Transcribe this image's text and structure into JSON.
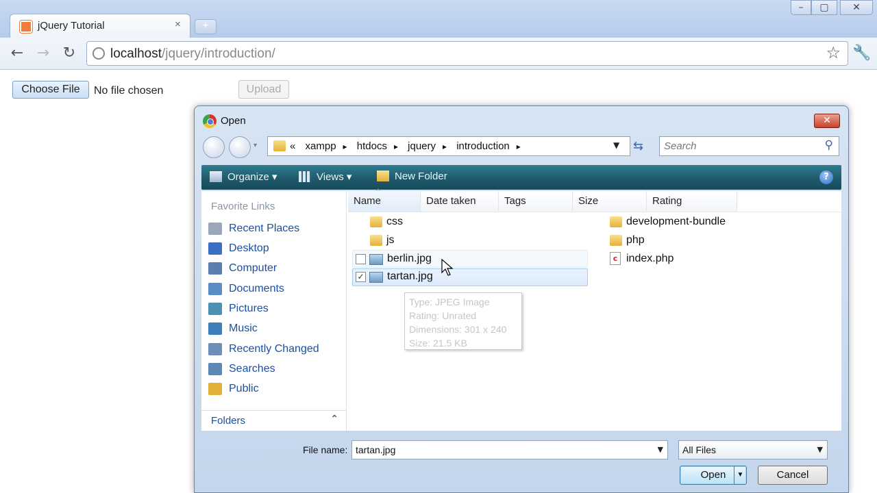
{
  "browser": {
    "tab_title": "jQuery Tutorial",
    "tab_close": "×",
    "new_tab": "+",
    "url_host": "localhost",
    "url_path": "/jquery/introduction/",
    "back": "←",
    "forward": "→",
    "reload": "↻",
    "bookmark": "☆",
    "menu": "🔧",
    "win_min": "–",
    "win_max": "▢",
    "win_close": "✕"
  },
  "page": {
    "choose_file": "Choose File",
    "no_file": "No file chosen",
    "upload": "Upload"
  },
  "dialog": {
    "title": "Open",
    "close": "✕",
    "breadcrumbs": [
      "«",
      "xampp",
      "htdocs",
      "jquery",
      "introduction"
    ],
    "search_placeholder": "Search",
    "toolbar": {
      "organize": "Organize ▾",
      "views": "Views ▾",
      "new_folder": "New Folder"
    },
    "favorite_links_header": "Favorite Links",
    "favorite_links": [
      {
        "label": "Recent Places",
        "icon": "recent-places-icon",
        "color": "#9aa7b8"
      },
      {
        "label": "Desktop",
        "icon": "desktop-icon",
        "color": "#3a6fc4"
      },
      {
        "label": "Computer",
        "icon": "computer-icon",
        "color": "#5a7fae"
      },
      {
        "label": "Documents",
        "icon": "documents-icon",
        "color": "#5c8cc6"
      },
      {
        "label": "Pictures",
        "icon": "pictures-icon",
        "color": "#4e8fb4"
      },
      {
        "label": "Music",
        "icon": "music-icon",
        "color": "#3e7fba"
      },
      {
        "label": "Recently Changed",
        "icon": "recently-changed-icon",
        "color": "#6f8fb8"
      },
      {
        "label": "Searches",
        "icon": "searches-icon",
        "color": "#5d88b6"
      },
      {
        "label": "Public",
        "icon": "public-folder-icon",
        "color": "#e3b13a"
      }
    ],
    "folders_label": "Folders",
    "columns": [
      "Name",
      "Date taken",
      "Tags",
      "Size",
      "Rating"
    ],
    "files_left": [
      {
        "name": "css",
        "type": "folder"
      },
      {
        "name": "js",
        "type": "folder"
      },
      {
        "name": "berlin.jpg",
        "type": "image",
        "checked": false
      },
      {
        "name": "tartan.jpg",
        "type": "image",
        "checked": true
      }
    ],
    "files_right": [
      {
        "name": "development-bundle",
        "type": "folder"
      },
      {
        "name": "php",
        "type": "folder"
      },
      {
        "name": "index.php",
        "type": "php"
      }
    ],
    "tooltip": {
      "type": "Type: JPEG Image",
      "rating": "Rating: Unrated",
      "dimensions": "Dimensions: 301 x 240",
      "size": "Size: 21.5 KB"
    },
    "file_name_label": "File name:",
    "file_name_value": "tartan.jpg",
    "file_type": "All Files",
    "open_button": "Open",
    "cancel_button": "Cancel"
  }
}
